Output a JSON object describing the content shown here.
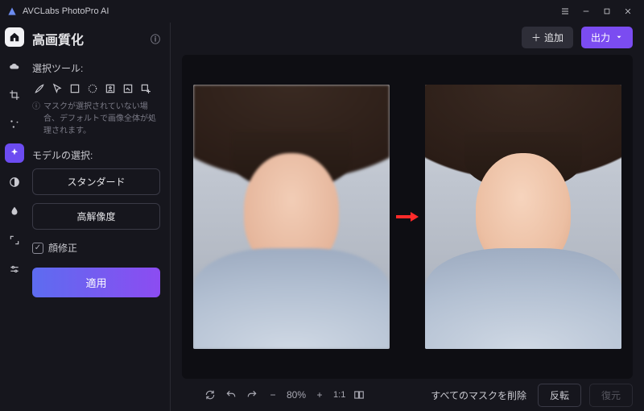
{
  "app": {
    "title": "AVCLabs PhotoPro AI"
  },
  "panel": {
    "title": "高画質化",
    "selection_label": "選択ツール:",
    "hint": "マスクが選択されていない場合、デフォルトで画像全体が処理されます。",
    "model_label": "モデルの選択:",
    "models": {
      "standard": "スタンダード",
      "highres": "高解像度"
    },
    "face_refine": "顔修正",
    "apply": "適用"
  },
  "topbar": {
    "add": "追加",
    "export": "出力"
  },
  "zoom": {
    "percent": "80%",
    "ratio": "1:1"
  },
  "bottom": {
    "delete_masks": "すべてのマスクを削除",
    "invert": "反転",
    "restore": "復元"
  }
}
